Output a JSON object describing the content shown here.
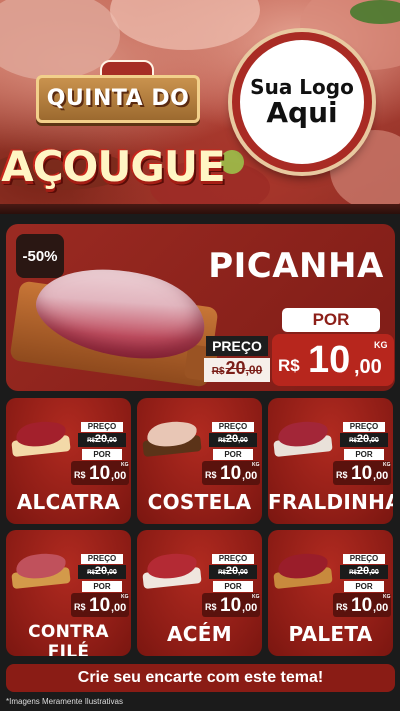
{
  "hero": {
    "title_line1": "QUINTA DO",
    "title_line2": "AÇOUGUE",
    "logo_line1": "Sua Logo",
    "logo_line2": "Aqui"
  },
  "feature": {
    "discount": "-50%",
    "name": "PICANHA",
    "preco_label": "PREÇO",
    "old_currency": "R$",
    "old_int": "20",
    "old_dec": ",00",
    "por_label": "POR",
    "currency": "R$",
    "price_int": "10",
    "price_dec": ",00",
    "unit": "KG"
  },
  "labels": {
    "preco": "PREÇO",
    "por": "POR",
    "currency": "R$",
    "unit": "KG"
  },
  "products": [
    {
      "name": "ALCATRA",
      "old_int": "20",
      "old_dec": ",00",
      "price_int": "10",
      "price_dec": ",00",
      "plate_color": "#f3d9a8",
      "meat_color": "#a3202c"
    },
    {
      "name": "COSTELA",
      "old_int": "20",
      "old_dec": ",00",
      "price_int": "10",
      "price_dec": ",00",
      "plate_color": "#5b3318",
      "meat_color": "#e8c6b5"
    },
    {
      "name": "FRALDINHA",
      "old_int": "20",
      "old_dec": ",00",
      "price_int": "10",
      "price_dec": ",00",
      "plate_color": "#e9e1d9",
      "meat_color": "#a32638"
    },
    {
      "name": "CONTRA FILÉ",
      "old_int": "20",
      "old_dec": ",00",
      "price_int": "10",
      "price_dec": ",00",
      "plate_color": "#d39a4a",
      "meat_color": "#c0515c"
    },
    {
      "name": "ACÉM",
      "old_int": "20",
      "old_dec": ",00",
      "price_int": "10",
      "price_dec": ",00",
      "plate_color": "#efe6de",
      "meat_color": "#b42a34"
    },
    {
      "name": "PALETA",
      "old_int": "20",
      "old_dec": ",00",
      "price_int": "10",
      "price_dec": ",00",
      "plate_color": "#c88a3d",
      "meat_color": "#9a1d2a"
    }
  ],
  "footer": {
    "cta": "Crie seu encarte com este tema!",
    "disclaimer": "*Imagens Meramente Ilustrativas"
  }
}
